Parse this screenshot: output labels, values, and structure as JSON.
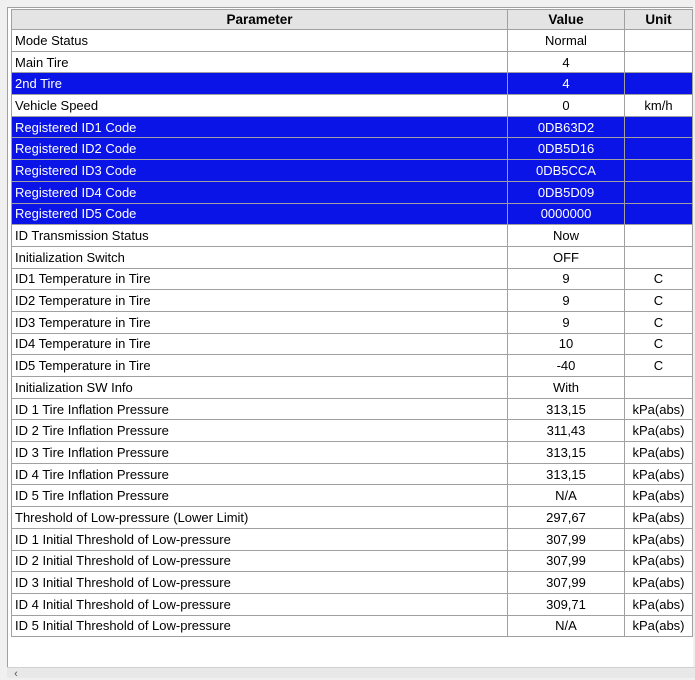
{
  "headers": {
    "parameter": "Parameter",
    "value": "Value",
    "unit": "Unit"
  },
  "rows": [
    {
      "parameter": "Mode Status",
      "value": "Normal",
      "unit": "",
      "selected": false
    },
    {
      "parameter": "Main Tire",
      "value": "4",
      "unit": "",
      "selected": false
    },
    {
      "parameter": "2nd Tire",
      "value": "4",
      "unit": "",
      "selected": true
    },
    {
      "parameter": "Vehicle Speed",
      "value": "0",
      "unit": "km/h",
      "selected": false
    },
    {
      "parameter": "Registered ID1 Code",
      "value": "0DB63D2",
      "unit": "",
      "selected": true
    },
    {
      "parameter": "Registered ID2 Code",
      "value": "0DB5D16",
      "unit": "",
      "selected": true
    },
    {
      "parameter": "Registered ID3 Code",
      "value": "0DB5CCA",
      "unit": "",
      "selected": true
    },
    {
      "parameter": "Registered ID4 Code",
      "value": "0DB5D09",
      "unit": "",
      "selected": true
    },
    {
      "parameter": "Registered ID5 Code",
      "value": "0000000",
      "unit": "",
      "selected": true
    },
    {
      "parameter": "ID Transmission Status",
      "value": "Now",
      "unit": "",
      "selected": false
    },
    {
      "parameter": "Initialization Switch",
      "value": "OFF",
      "unit": "",
      "selected": false
    },
    {
      "parameter": "ID1 Temperature in Tire",
      "value": "9",
      "unit": "C",
      "selected": false
    },
    {
      "parameter": "ID2 Temperature in Tire",
      "value": "9",
      "unit": "C",
      "selected": false
    },
    {
      "parameter": "ID3 Temperature in Tire",
      "value": "9",
      "unit": "C",
      "selected": false
    },
    {
      "parameter": "ID4 Temperature in Tire",
      "value": "10",
      "unit": "C",
      "selected": false
    },
    {
      "parameter": "ID5 Temperature in Tire",
      "value": "-40",
      "unit": "C",
      "selected": false
    },
    {
      "parameter": "Initialization SW Info",
      "value": "With",
      "unit": "",
      "selected": false
    },
    {
      "parameter": "ID 1 Tire Inflation Pressure",
      "value": "313,15",
      "unit": "kPa(abs)",
      "selected": false
    },
    {
      "parameter": "ID 2 Tire Inflation Pressure",
      "value": "311,43",
      "unit": "kPa(abs)",
      "selected": false
    },
    {
      "parameter": "ID 3 Tire Inflation Pressure",
      "value": "313,15",
      "unit": "kPa(abs)",
      "selected": false
    },
    {
      "parameter": "ID 4 Tire Inflation Pressure",
      "value": "313,15",
      "unit": "kPa(abs)",
      "selected": false
    },
    {
      "parameter": "ID 5 Tire Inflation Pressure",
      "value": "N/A",
      "unit": "kPa(abs)",
      "selected": false
    },
    {
      "parameter": "Threshold of Low-pressure (Lower Limit)",
      "value": "297,67",
      "unit": "kPa(abs)",
      "selected": false
    },
    {
      "parameter": "ID 1 Initial Threshold of Low-pressure",
      "value": "307,99",
      "unit": "kPa(abs)",
      "selected": false
    },
    {
      "parameter": "ID 2 Initial Threshold of Low-pressure",
      "value": "307,99",
      "unit": "kPa(abs)",
      "selected": false
    },
    {
      "parameter": "ID 3 Initial Threshold of Low-pressure",
      "value": "307,99",
      "unit": "kPa(abs)",
      "selected": false
    },
    {
      "parameter": "ID 4 Initial Threshold of Low-pressure",
      "value": "309,71",
      "unit": "kPa(abs)",
      "selected": false
    },
    {
      "parameter": "ID 5 Initial Threshold of Low-pressure",
      "value": "N/A",
      "unit": "kPa(abs)",
      "selected": false
    }
  ],
  "colors": {
    "selection": "#0a14e6",
    "header_bg": "#e4e4e4",
    "grid_line": "#a0a0a0"
  },
  "scrollbar": {
    "left_arrow_icon": "chevron-left-icon",
    "left_arrow_glyph": "‹"
  }
}
